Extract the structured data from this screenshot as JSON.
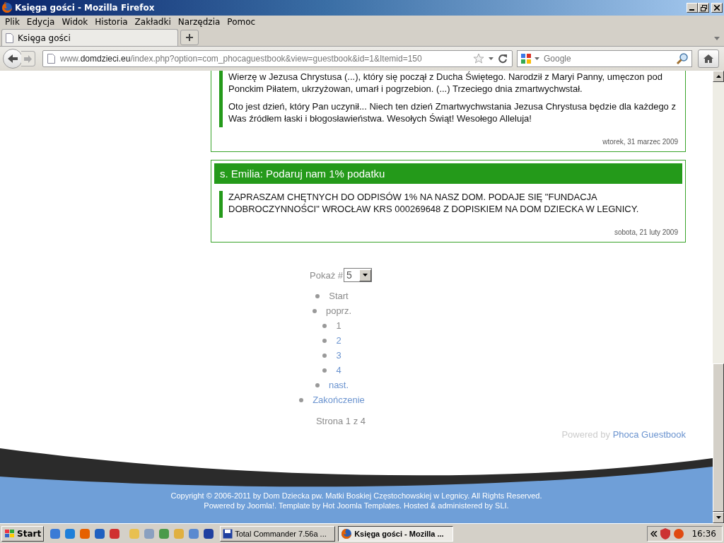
{
  "window": {
    "title": "Księga gości - Mozilla Firefox"
  },
  "menu": [
    "Plik",
    "Edycja",
    "Widok",
    "Historia",
    "Zakładki",
    "Narzędzia",
    "Pomoc"
  ],
  "tabs": [
    {
      "label": "Księga gości",
      "selected": true
    }
  ],
  "address_bar": {
    "prefix": "www.",
    "domain": "domdzieci.eu",
    "path": "/index.php?option=com_phocaguestbook&view=guestbook&id=1&Itemid=150"
  },
  "search": {
    "placeholder": "Google"
  },
  "posts": [
    {
      "paragraphs": [
        "Wierzę w Jezusa Chrystusa (...), który się począł z Ducha Świętego. Narodził z Maryi Panny, umęczon pod Ponckim Piłatem, ukrzyżowan, umarł i pogrzebion. (...) Trzeciego dnia zmartwychwstał.",
        "Oto jest dzień, który Pan uczynił... Niech ten dzień Zmartwychwstania Jezusa Chrystusa będzie dla każdego z Was źródłem łaski i błogosławieństwa. Wesołych Świąt! Wesołego Alleluja!"
      ],
      "date": "wtorek, 31 marzec 2009"
    },
    {
      "header": "s. Emilia: Podaruj nam 1% podatku",
      "paragraphs": [
        "ZAPRASZAM CHĘTNYCH DO ODPISÓW 1% NA NASZ DOM. PODAJE SIĘ \"FUNDACJA DOBROCZYNNOŚCI\" WROCŁAW KRS 000269648 Z DOPISKIEM NA DOM DZIECKA W LEGNICY."
      ],
      "date": "sobota, 21 luty 2009"
    }
  ],
  "pagination": {
    "label": "Pokaż #",
    "page_size": "5",
    "pages": [
      {
        "label": "Start",
        "kind": "inactive"
      },
      {
        "label": "poprz.",
        "kind": "inactive"
      },
      {
        "label": "1",
        "kind": "inactive"
      },
      {
        "label": "2",
        "kind": "link"
      },
      {
        "label": "3",
        "kind": "link"
      },
      {
        "label": "4",
        "kind": "link"
      },
      {
        "label": "nast.",
        "kind": "link"
      },
      {
        "label": "Zakończenie",
        "kind": "link"
      }
    ],
    "summary": "Strona 1 z 4"
  },
  "powered_by": {
    "text": "Powered by",
    "link": "Phoca Guestbook"
  },
  "footer": [
    "Copyright © 2006-2011 by Dom Dziecka pw. Matki Boskiej Częstochowskiej w Legnicy. All Rights Reserved.",
    "Powered by Joomla!. Template by Hot Joomla Templates. Hosted & administered by SLI."
  ],
  "taskbar": {
    "start": "Start",
    "tasks": [
      {
        "label": "Total Commander 7.56a ...",
        "selected": false
      },
      {
        "label": "Księga gości - Mozilla ...",
        "selected": true
      }
    ],
    "clock": "16:36"
  }
}
